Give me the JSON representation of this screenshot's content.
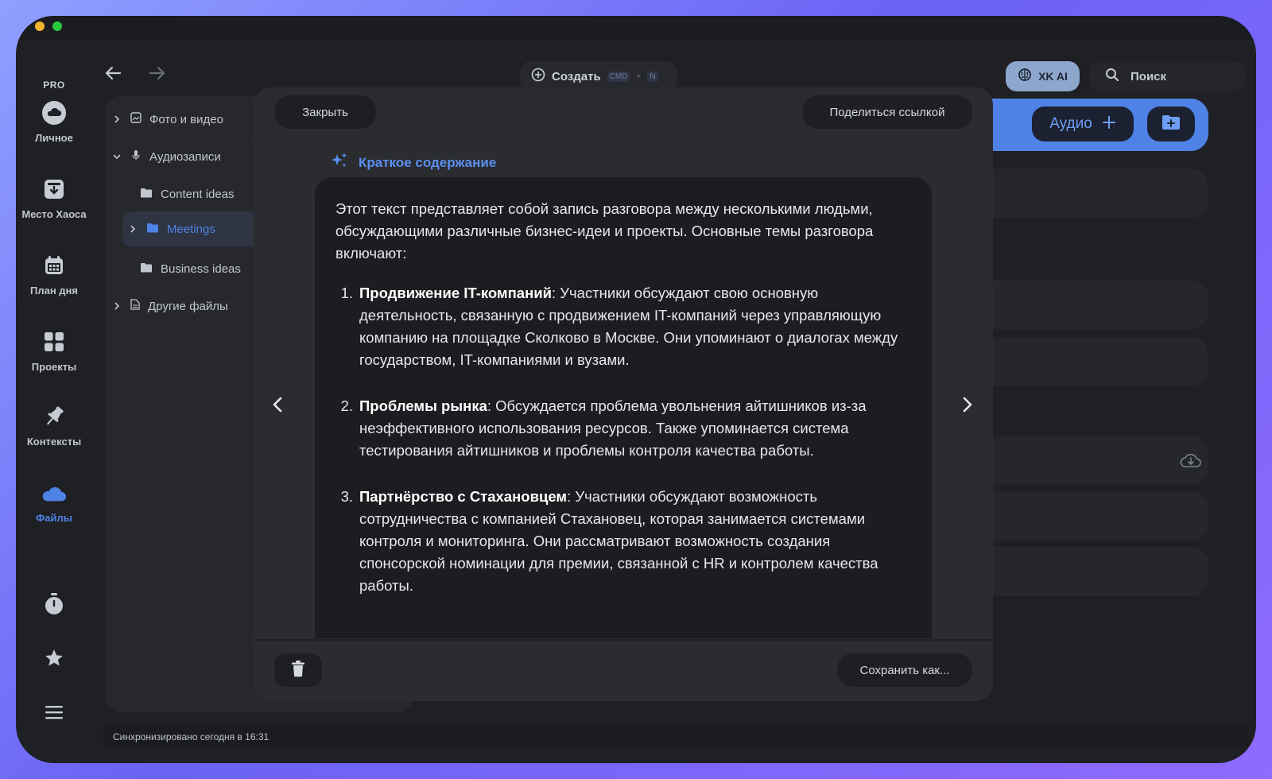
{
  "sidebar": {
    "plan": "PRO",
    "items": [
      {
        "label": "Личное",
        "icon": "cloud-icon"
      },
      {
        "label": "Место Хаоса",
        "icon": "inbox-icon"
      },
      {
        "label": "План дня",
        "icon": "calendar-icon"
      },
      {
        "label": "Проекты",
        "icon": "grid-icon"
      },
      {
        "label": "Контексты",
        "icon": "pin-icon"
      },
      {
        "label": "Файлы",
        "icon": "files-cloud-icon"
      }
    ],
    "bottom_icons": [
      "timer-icon",
      "star-icon",
      "menu-icon"
    ]
  },
  "toolbar": {
    "create_label": "Создать",
    "shortcut_key1": "CMD",
    "shortcut_plus": "+",
    "shortcut_key2": "N",
    "ai_label": "XK AI",
    "search_label": "Поиск"
  },
  "folders": [
    {
      "label": "Фото и видео"
    },
    {
      "label": "Аудиозаписи"
    },
    {
      "label": "Content ideas"
    },
    {
      "label": "Meetings"
    },
    {
      "label": "Business ideas"
    },
    {
      "label": "Другие файлы"
    }
  ],
  "right_panel": {
    "audio_label": "Аудио"
  },
  "modal": {
    "close_label": "Закрыть",
    "share_label": "Поделиться ссылкой",
    "section_title": "Краткое содержание",
    "intro": "Этот текст представляет собой запись разговора между несколькими людьми, обсуждающими различные бизнес-идеи и проекты. Основные темы разговора включают:",
    "points": [
      {
        "num": "1.",
        "title": "Продвижение IT-компаний",
        "text": ": Участники обсуждают свою основную деятельность, связанную с продвижением IT-компаний через управляющую компанию на площадке Сколково в Москве. Они упоминают о диалогах между государством, IT-компаниями и вузами."
      },
      {
        "num": "2.",
        "title": "Проблемы рынка",
        "text": ": Обсуждается проблема увольнения айтишников из-за неэффективного использования ресурсов. Также упоминается система тестирования айтишников и проблемы контроля качества работы."
      },
      {
        "num": "3.",
        "title": "Партнёрство с Стахановцем",
        "text": ": Участники обсуждают возможность сотрудничества с компанией Стахановец, которая занимается системами контроля и мониторинга. Они рассматривают возможность создания спонсорской номинации для премии, связанной с HR и контролем качества работы."
      }
    ],
    "save_label": "Сохранить как..."
  },
  "status": {
    "sync_text": "Синхронизировано сегодня в 16:31"
  },
  "colors": {
    "accent": "#4f82e6",
    "ai_button": "#8da6cc",
    "window_bg": "#1e2024"
  }
}
